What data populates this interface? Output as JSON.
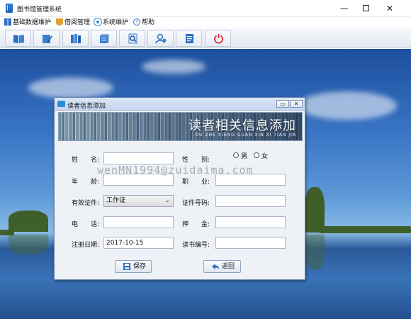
{
  "window": {
    "title": "图书馆管理系统",
    "controls": {
      "minimize": "—",
      "close": "✕"
    }
  },
  "menu": {
    "items": [
      {
        "label": "基础数据维护",
        "icon": "grid-icon"
      },
      {
        "label": "借阅管理",
        "icon": "cup-icon"
      },
      {
        "label": "系统维护",
        "icon": "gear-icon"
      },
      {
        "label": "帮助",
        "icon": "help-icon"
      }
    ]
  },
  "toolbar": {
    "buttons": [
      {
        "icon": "book-open-icon"
      },
      {
        "icon": "edit-book-icon"
      },
      {
        "icon": "books-icon"
      },
      {
        "icon": "card-list-icon"
      },
      {
        "icon": "search-document-icon"
      },
      {
        "icon": "users-icon"
      },
      {
        "icon": "form-document-icon"
      },
      {
        "icon": "power-icon"
      }
    ]
  },
  "dialog": {
    "title": "读者信息添加",
    "controls": {
      "minimize": "▭",
      "close": "✕"
    },
    "banner": {
      "title": "读者相关信息添加",
      "subtitle": "DU ZHE XIANG GUAN XIN XI TIAN JIA"
    },
    "form": {
      "name_label": "姓　　名:",
      "name_value": "",
      "gender_label": "性　　别:",
      "gender_options": [
        "男",
        "女"
      ],
      "age_label": "年　　龄:",
      "age_value": "",
      "job_label": "职　　业:",
      "job_value": "",
      "id_type_label": "有效证件:",
      "id_type_value": "工作证",
      "id_number_label": "证件号码:",
      "id_number_value": "",
      "phone_label": "电　　话:",
      "phone_value": "",
      "deposit_label": "押　　金:",
      "deposit_value": "",
      "reg_date_label": "注册日期:",
      "reg_date_value": "2017-10-15",
      "reader_no_label": "读书编号:",
      "reader_no_value": ""
    },
    "buttons": {
      "save_label": "保存",
      "back_label": "返回"
    }
  },
  "watermark": "wenMN1994@zuidaima.com"
}
